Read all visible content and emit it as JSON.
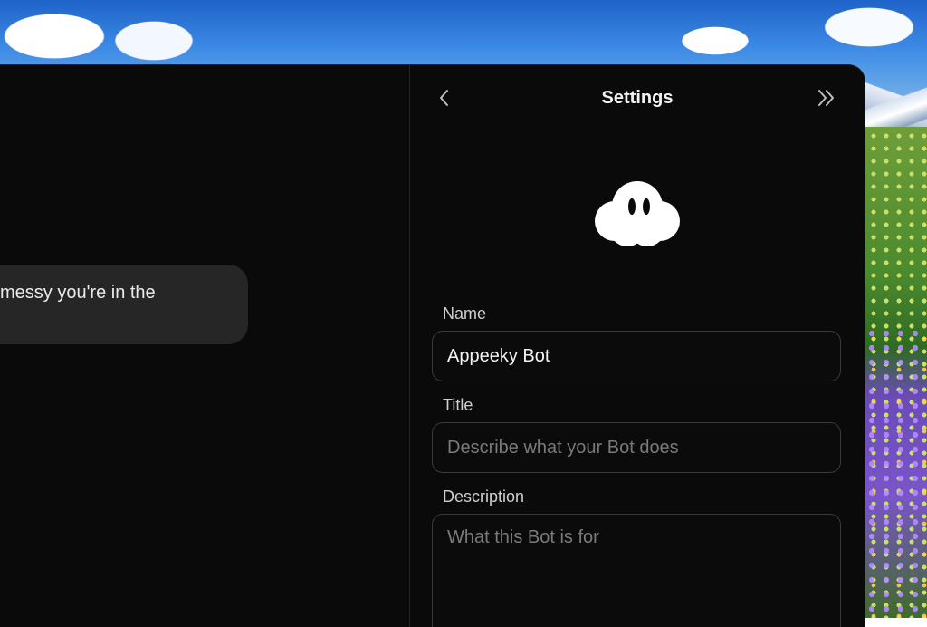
{
  "chat": {
    "bubble_text": "messy you're in the"
  },
  "settings": {
    "title": "Settings",
    "back_icon": "chevron-left-icon",
    "collapse_icon": "double-chevron-right-icon",
    "avatar_icon": "cloud-face-icon",
    "name": {
      "label": "Name",
      "value": "Appeeky Bot"
    },
    "title_field": {
      "label": "Title",
      "placeholder": "Describe what your Bot does"
    },
    "description": {
      "label": "Description",
      "placeholder": "What this Bot is for"
    }
  },
  "colors": {
    "window_bg": "#0a0a0a",
    "bubble_bg": "#262626",
    "input_border": "#3a3a3a",
    "text_primary": "#f2f2f2",
    "text_placeholder": "#7a7a7a"
  }
}
